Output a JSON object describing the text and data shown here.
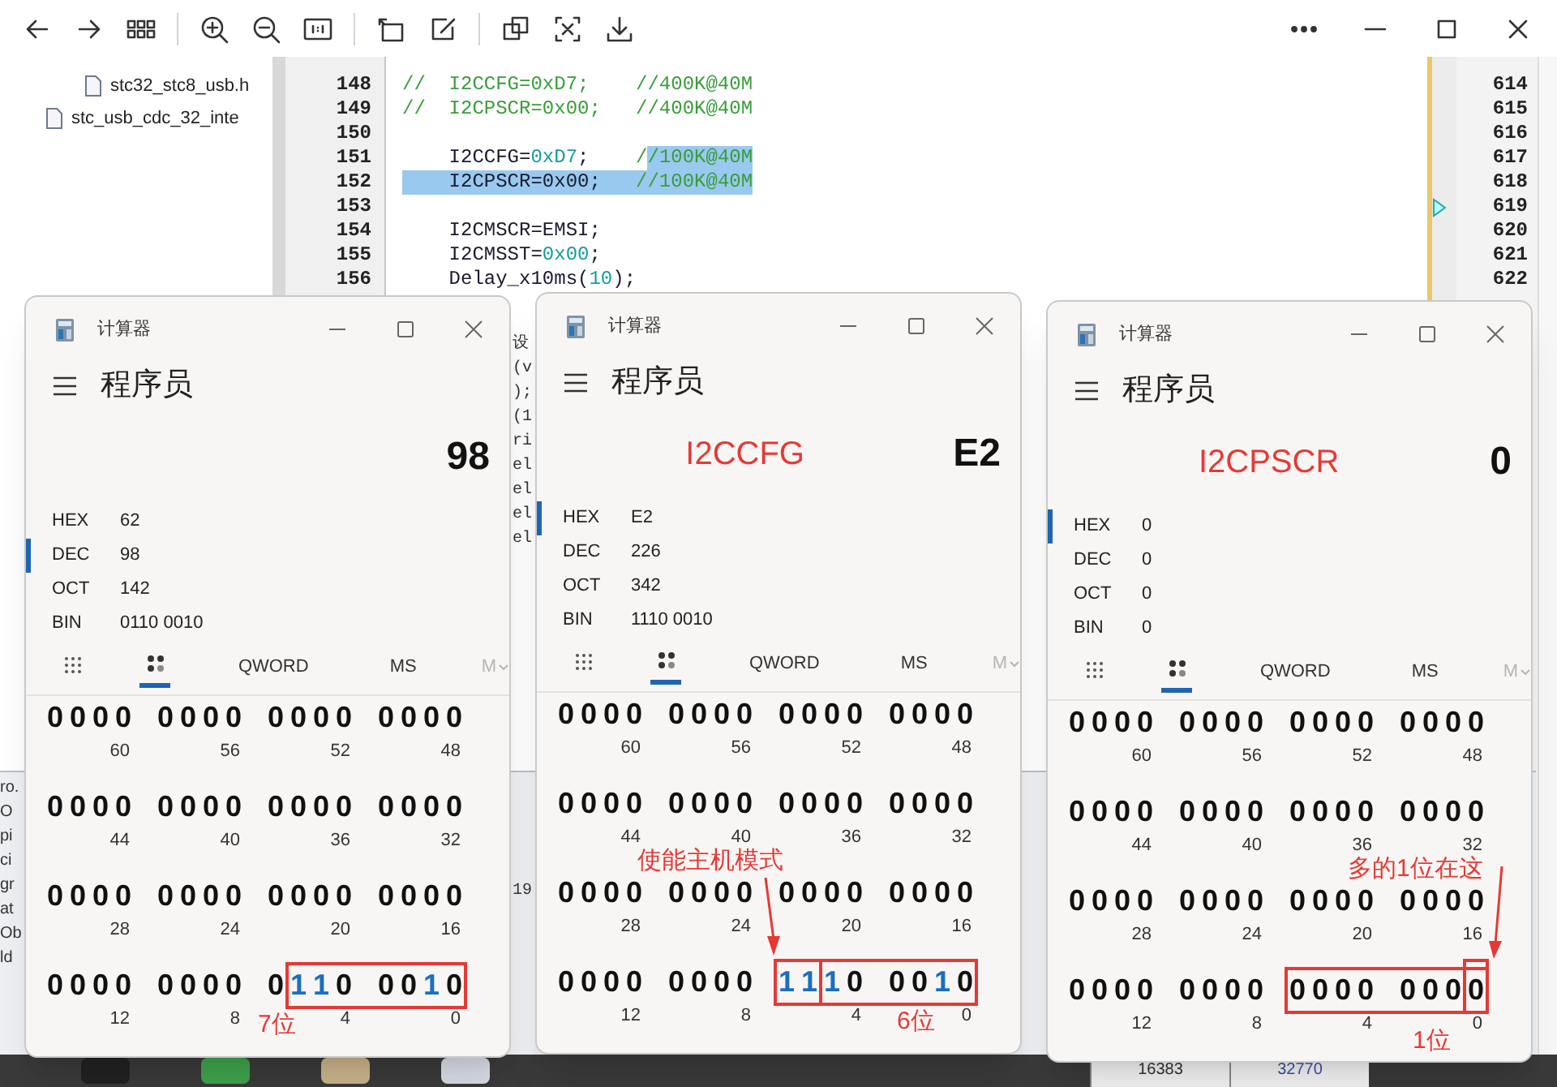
{
  "file_tree": [
    {
      "children": [
        {
          "label": "stc32_stc8_usb.h"
        }
      ]
    },
    {
      "label": "stc_usb_cdc_32_inte"
    }
  ],
  "editor": {
    "lines": [
      {
        "number": "148",
        "segments": [
          {
            "text": "//  I2CCFG=0xD7;    //400K@40M",
            "kind": "comment",
            "selected": false
          }
        ]
      },
      {
        "number": "149",
        "segments": [
          {
            "text": "//  I2CPSCR=0x00;   //400K@40M",
            "kind": "comment",
            "selected": false
          }
        ]
      },
      {
        "number": "150"
      },
      {
        "number": "151",
        "segments": [
          {
            "text": "    I2CCFG=",
            "kind": "plain",
            "selected": false
          },
          {
            "text": "0xD7",
            "kind": "number",
            "selected": false
          },
          {
            "text": ";    ",
            "kind": "plain",
            "selected": false
          },
          {
            "text": "/",
            "kind": "comment",
            "selected": false
          },
          {
            "text": "/100K@40M",
            "kind": "comment",
            "selected": true
          }
        ]
      },
      {
        "number": "152",
        "segments": [
          {
            "text": "    I2CPSCR=0x00;   ",
            "kind": "plain",
            "selected": true
          },
          {
            "text": "//100K@40M",
            "kind": "comment",
            "selected": true
          }
        ]
      },
      {
        "number": "153"
      },
      {
        "number": "154",
        "segments": [
          {
            "text": "    I2CMSCR=EMSI;",
            "kind": "plain",
            "selected": false
          }
        ]
      },
      {
        "number": "155",
        "segments": [
          {
            "text": "    I2CMSST=",
            "kind": "plain",
            "selected": false
          },
          {
            "text": "0x00",
            "kind": "number",
            "selected": false
          },
          {
            "text": ";",
            "kind": "plain",
            "selected": false
          }
        ]
      },
      {
        "number": "156",
        "segments": [
          {
            "text": "    Delay_x10ms(",
            "kind": "plain",
            "selected": false
          },
          {
            "text": "10",
            "kind": "number",
            "selected": false
          },
          {
            "text": ");",
            "kind": "plain",
            "selected": false
          }
        ]
      }
    ]
  },
  "right_panel": {
    "lines": [
      {
        "number": "614",
        "marker": false
      },
      {
        "number": "615",
        "marker": false
      },
      {
        "number": "616",
        "marker": false
      },
      {
        "number": "617",
        "marker": false
      },
      {
        "number": "618",
        "marker": false
      },
      {
        "number": "619",
        "marker": true
      },
      {
        "number": "620",
        "marker": false
      },
      {
        "number": "621",
        "marker": false
      },
      {
        "number": "622",
        "marker": false
      }
    ]
  },
  "covered_code_fragments": [
    "设",
    "(v",
    ");",
    "(1",
    "ri",
    "el",
    "el",
    "el",
    "el"
  ],
  "covered_output_fragments": [
    "ro.",
    "O",
    "pi",
    "ci",
    "gr",
    "at",
    "Ob",
    "ld"
  ],
  "covered_number": "19",
  "bottom_table": [
    "16383",
    "32770"
  ],
  "calculators": [
    {
      "title": "计算器",
      "mode": "程序员",
      "display": "98",
      "bases": [
        {
          "name": "HEX",
          "value": "62",
          "selected": false
        },
        {
          "name": "DEC",
          "value": "98",
          "selected": true
        },
        {
          "name": "OCT",
          "value": "142",
          "selected": false
        },
        {
          "name": "BIN",
          "value": "0110 0010",
          "selected": false
        }
      ],
      "view_toggles": [
        {
          "kind": "keypad",
          "selected": false
        },
        {
          "kind": "bits",
          "selected": true
        }
      ],
      "word_size": "QWORD",
      "memory_store": "MS",
      "memory_menu": {
        "label": "M",
        "disabled": true
      },
      "bit_rows": [
        [
          {
            "bits": "0000",
            "index": "60"
          },
          {
            "bits": "0000",
            "index": "56"
          },
          {
            "bits": "0000",
            "index": "52"
          },
          {
            "bits": "0000",
            "index": "48"
          }
        ],
        [
          {
            "bits": "0000",
            "index": "44"
          },
          {
            "bits": "0000",
            "index": "40"
          },
          {
            "bits": "0000",
            "index": "36"
          },
          {
            "bits": "0000",
            "index": "32"
          }
        ],
        [
          {
            "bits": "0000",
            "index": "28"
          },
          {
            "bits": "0000",
            "index": "24"
          },
          {
            "bits": "0000",
            "index": "20"
          },
          {
            "bits": "0000",
            "index": "16"
          }
        ],
        [
          {
            "bits": "0000",
            "index": "12"
          },
          {
            "bits": "0000",
            "index": "8"
          },
          {
            "bits": "0110",
            "index": "4"
          },
          {
            "bits": "0010",
            "index": "0"
          }
        ]
      ],
      "notes": [
        {
          "kind": "box"
        },
        {
          "kind": "text",
          "text": "7位"
        }
      ]
    },
    {
      "title": "计算器",
      "mode": "程序员",
      "tag": "I2CCFG",
      "display": "E2",
      "bases": [
        {
          "name": "HEX",
          "value": "E2",
          "selected": true
        },
        {
          "name": "DEC",
          "value": "226",
          "selected": false
        },
        {
          "name": "OCT",
          "value": "342",
          "selected": false
        },
        {
          "name": "BIN",
          "value": "1110 0010",
          "selected": false
        }
      ],
      "view_toggles": [
        {
          "kind": "keypad",
          "selected": false
        },
        {
          "kind": "bits",
          "selected": true
        }
      ],
      "word_size": "QWORD",
      "memory_store": "MS",
      "memory_menu": {
        "label": "M",
        "disabled": true
      },
      "bit_rows": [
        [
          {
            "bits": "0000",
            "index": "60"
          },
          {
            "bits": "0000",
            "index": "56"
          },
          {
            "bits": "0000",
            "index": "52"
          },
          {
            "bits": "0000",
            "index": "48"
          }
        ],
        [
          {
            "bits": "0000",
            "index": "44"
          },
          {
            "bits": "0000",
            "index": "40"
          },
          {
            "bits": "0000",
            "index": "36"
          },
          {
            "bits": "0000",
            "index": "32"
          }
        ],
        [
          {
            "bits": "0000",
            "index": "28"
          },
          {
            "bits": "0000",
            "index": "24"
          },
          {
            "bits": "0000",
            "index": "20"
          },
          {
            "bits": "0000",
            "index": "16"
          }
        ],
        [
          {
            "bits": "0000",
            "index": "12"
          },
          {
            "bits": "0000",
            "index": "8"
          },
          {
            "bits": "1110",
            "index": "4"
          },
          {
            "bits": "0010",
            "index": "0"
          }
        ]
      ],
      "notes": [
        {
          "kind": "box"
        },
        {
          "kind": "box"
        },
        {
          "kind": "arrow"
        },
        {
          "kind": "text",
          "text": "使能主机模式"
        },
        {
          "kind": "text",
          "text": "6位"
        }
      ]
    },
    {
      "title": "计算器",
      "mode": "程序员",
      "tag": "I2CPSCR",
      "display": "0",
      "bases": [
        {
          "name": "HEX",
          "value": "0",
          "selected": true
        },
        {
          "name": "DEC",
          "value": "0",
          "selected": false
        },
        {
          "name": "OCT",
          "value": "0",
          "selected": false
        },
        {
          "name": "BIN",
          "value": "0",
          "selected": false
        }
      ],
      "view_toggles": [
        {
          "kind": "keypad",
          "selected": false
        },
        {
          "kind": "bits",
          "selected": true
        }
      ],
      "word_size": "QWORD",
      "memory_store": "MS",
      "memory_menu": {
        "label": "M",
        "disabled": true
      },
      "bit_rows": [
        [
          {
            "bits": "0000",
            "index": "60"
          },
          {
            "bits": "0000",
            "index": "56"
          },
          {
            "bits": "0000",
            "index": "52"
          },
          {
            "bits": "0000",
            "index": "48"
          }
        ],
        [
          {
            "bits": "0000",
            "index": "44"
          },
          {
            "bits": "0000",
            "index": "40"
          },
          {
            "bits": "0000",
            "index": "36"
          },
          {
            "bits": "0000",
            "index": "32"
          }
        ],
        [
          {
            "bits": "0000",
            "index": "28"
          },
          {
            "bits": "0000",
            "index": "24"
          },
          {
            "bits": "0000",
            "index": "20"
          },
          {
            "bits": "0000",
            "index": "16"
          }
        ],
        [
          {
            "bits": "0000",
            "index": "12"
          },
          {
            "bits": "0000",
            "index": "8"
          },
          {
            "bits": "0000",
            "index": "4"
          },
          {
            "bits": "0000",
            "index": "0"
          }
        ]
      ],
      "notes": [
        {
          "kind": "box"
        },
        {
          "kind": "box"
        },
        {
          "kind": "text",
          "text": "多的1位在这"
        },
        {
          "kind": "arrow"
        },
        {
          "kind": "text",
          "text": "1位"
        }
      ]
    }
  ]
}
